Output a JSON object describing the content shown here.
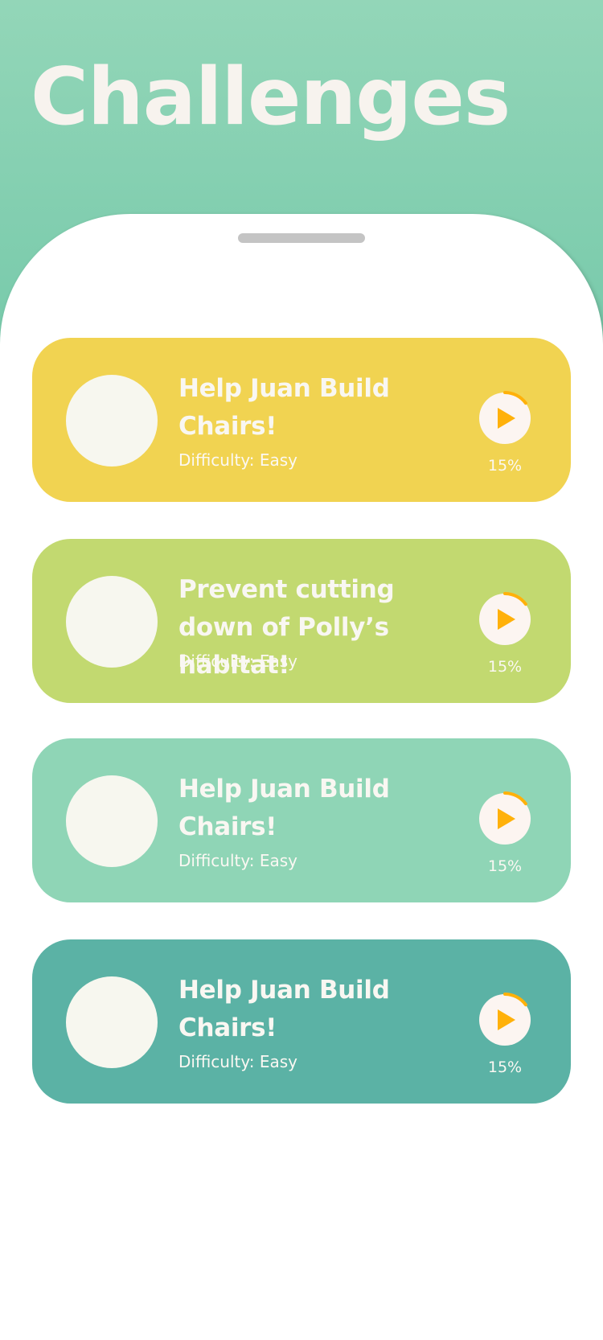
{
  "header": {
    "title": "Challenges"
  },
  "colors": {
    "header_gradient_top": "#93d6b8",
    "header_gradient_bottom": "#76c9aa",
    "progress_ring": "#ffb10a",
    "play_triangle": "#ffb10a"
  },
  "challenges": [
    {
      "title": "Help Juan Build Chairs!",
      "difficulty": "Difficulty: Easy",
      "progress_label": "15%",
      "progress": 0.15,
      "color": "#f1d351"
    },
    {
      "title": "Prevent cutting down of Polly’s habitat!",
      "difficulty": "Difficulty: Easy",
      "progress_label": "15%",
      "progress": 0.15,
      "color": "#c2d970"
    },
    {
      "title": "Help Juan Build Chairs!",
      "difficulty": "Difficulty: Easy",
      "progress_label": "15%",
      "progress": 0.15,
      "color": "#8fd5b6"
    },
    {
      "title": "Help Juan Build Chairs!",
      "difficulty": "Difficulty: Easy",
      "progress_label": "15%",
      "progress": 0.15,
      "color": "#5bb2a5"
    }
  ]
}
